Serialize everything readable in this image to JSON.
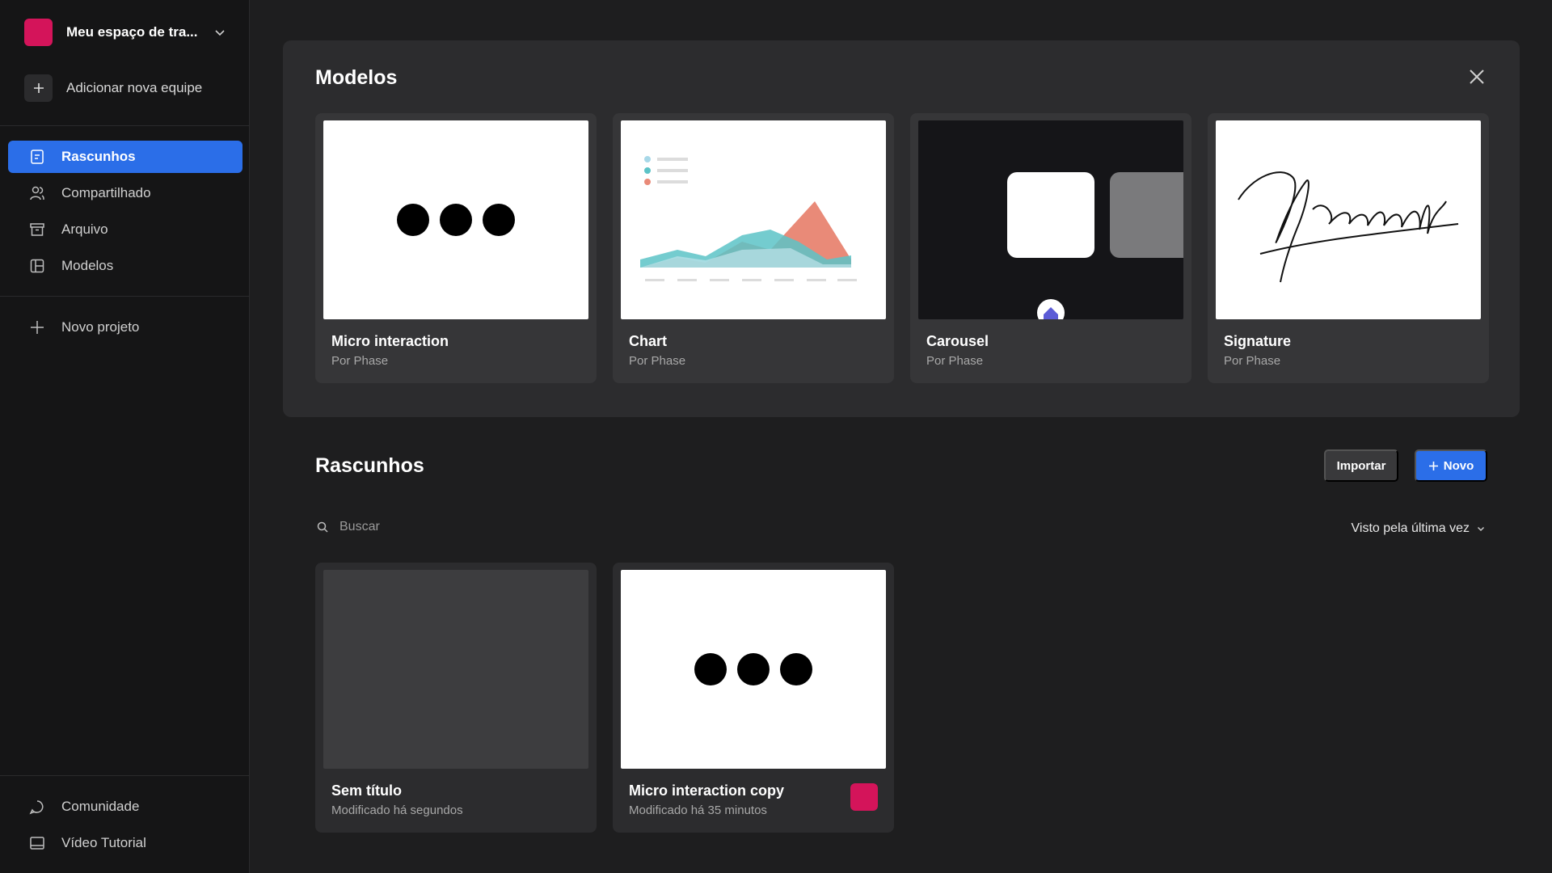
{
  "workspace": {
    "name": "Meu espaço de tra...",
    "color": "#d4145a"
  },
  "sidebar": {
    "add_team": "Adicionar nova equipe",
    "items": [
      {
        "label": "Rascunhos",
        "icon": "file-icon",
        "active": true
      },
      {
        "label": "Compartilhado",
        "icon": "users-icon"
      },
      {
        "label": "Arquivo",
        "icon": "archive-icon"
      },
      {
        "label": "Modelos",
        "icon": "layout-icon"
      }
    ],
    "new_project": "Novo projeto",
    "footer": [
      {
        "label": "Comunidade",
        "icon": "chat-icon"
      },
      {
        "label": "Vídeo Tutorial",
        "icon": "video-icon"
      }
    ]
  },
  "templates": {
    "title": "Modelos",
    "cards": [
      {
        "title": "Micro interaction",
        "author": "Por Phase"
      },
      {
        "title": "Chart",
        "author": "Por Phase"
      },
      {
        "title": "Carousel",
        "author": "Por Phase"
      },
      {
        "title": "Signature",
        "author": "Por Phase"
      }
    ]
  },
  "drafts": {
    "title": "Rascunhos",
    "import_label": "Importar",
    "new_label": "Novo",
    "search_placeholder": "Buscar",
    "sort_label": "Visto pela última vez",
    "items": [
      {
        "title": "Sem título",
        "modified": "Modificado há segundos"
      },
      {
        "title": "Micro interaction copy",
        "modified": "Modificado há 35 minutos",
        "color": "#d4145a"
      }
    ]
  },
  "colors": {
    "accent": "#2b6ee8",
    "brand": "#d4145a"
  }
}
